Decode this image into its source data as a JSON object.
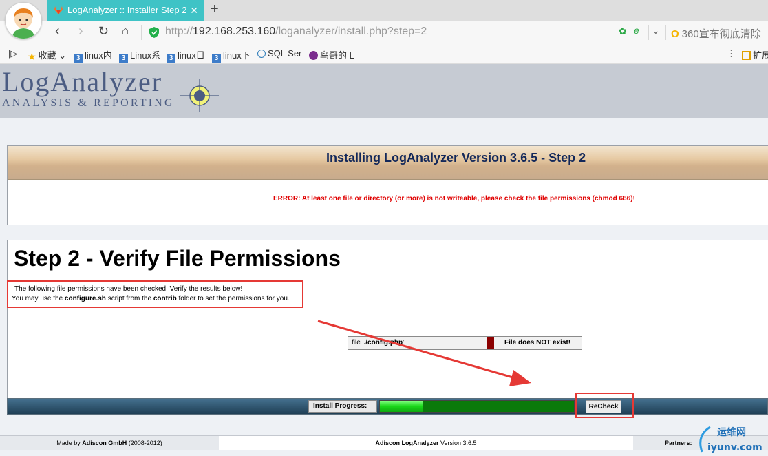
{
  "browser": {
    "tab_title": "LogAnalyzer :: Installer Step 2",
    "url_prefix": "http://",
    "url_host": "192.168.253.160",
    "url_path": "/loganalyzer/install.php?step=2",
    "search_text": "360宣布彻底清除",
    "bookmarks": [
      {
        "label": "收藏"
      },
      {
        "label": "linux内"
      },
      {
        "label": "Linux系"
      },
      {
        "label": "linux目"
      },
      {
        "label": "linux下"
      },
      {
        "label": "SQL Ser"
      },
      {
        "label": "鸟哥的 L"
      }
    ],
    "extensions_label": "扩展"
  },
  "logo": {
    "main": "LogAnalyzer",
    "sub": "ANALYSIS & REPORTING"
  },
  "installer": {
    "title": "Installing LogAnalyzer Version 3.6.5 - Step 2",
    "error": "ERROR: At least one file or directory (or more) is not writeable, please check the file permissions (chmod 666)!",
    "step_heading": "Step 2 - Verify File Permissions",
    "desc_line1": "The following file permissions have been checked. Verify the results below!",
    "desc_line2_a": "You may use the ",
    "desc_line2_b": "configure.sh",
    "desc_line2_c": " script from the ",
    "desc_line2_d": "contrib",
    "desc_line2_e": " folder to set the permissions for you.",
    "file_prefix": "file '",
    "file_name": "./config.php",
    "file_suffix": "'",
    "file_status": "File does NOT exist!",
    "progress_label": "Install Progress:",
    "progress_fraction": 0.22,
    "recheck_label": "ReCheck"
  },
  "footer": {
    "made_by_prefix": "Made by ",
    "made_by_company": "Adiscon GmbH",
    "made_by_years": " (2008-2012)",
    "product_name": "Adiscon LogAnalyzer",
    "product_version": " Version 3.6.5",
    "partners": "Partners:"
  },
  "watermark": {
    "top": "运维网",
    "bottom": "iyunv.com"
  },
  "colors": {
    "tab_accent": "#3fc3c6",
    "error_red": "#e00000",
    "title_navy": "#13285a",
    "progress_green": "#19d719",
    "annotation_red": "#e53935"
  }
}
